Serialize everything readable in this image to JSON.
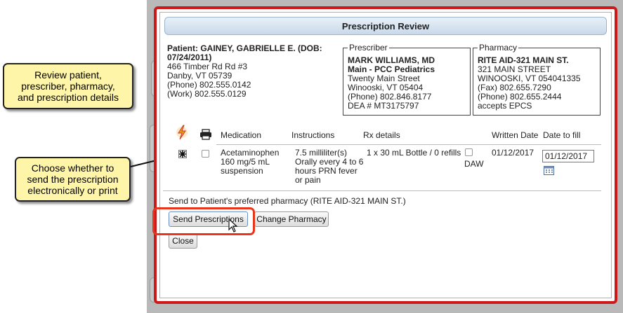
{
  "modal": {
    "title": "Prescription Review"
  },
  "patient": {
    "name_line1": "Patient: GAINEY, GABRIELLE E. (DOB:",
    "name_line2": "07/24/2011)",
    "address1": "466 Timber Rd Rd #3",
    "address2": "Danby, VT 05739",
    "phone": "(Phone) 802.555.0142",
    "work": "(Work) 802.555.0129"
  },
  "prescriber": {
    "legend": "Prescriber",
    "name": "MARK WILLIAMS, MD",
    "practice": "Main - PCC Pediatrics",
    "address1": "Twenty Main Street",
    "address2": "Winooski, VT 05404",
    "phone": "(Phone) 802.846.8177",
    "dea": "DEA # MT3175797"
  },
  "pharmacy": {
    "legend": "Pharmacy",
    "name": "RITE AID-321 MAIN ST.",
    "address1": "321 MAIN STREET",
    "address2": "WINOOSKI, VT 054041335",
    "fax": "(Fax) 802.655.7290",
    "phone": "(Phone) 802.655.2444",
    "epcs": "accepts EPCS"
  },
  "table": {
    "headers": {
      "medication": "Medication",
      "instructions": "Instructions",
      "rx_details": "Rx details",
      "written_date": "Written Date",
      "date_to_fill": "Date to fill"
    },
    "row": {
      "medication_1": "Acetaminophen",
      "medication_2": "160 mg/5 mL",
      "medication_3": "suspension",
      "instructions_1": "7.5 milliliter(s)",
      "instructions_2": "Orally every 4 to 6",
      "instructions_3": "hours PRN fever",
      "instructions_4": "or pain",
      "rx_details": "1 x 30 mL Bottle / 0 refills",
      "daw": "DAW",
      "written_date": "01/12/2017",
      "date_to_fill": "01/12/2017"
    }
  },
  "send_note": "Send to Patient's preferred pharmacy (RITE AID-321 MAIN ST.)",
  "buttons": {
    "send": "Send Prescriptions",
    "change_pharmacy": "Change Pharmacy",
    "close": "Close"
  },
  "callouts": {
    "review": "Review patient,\nprescriber, pharmacy,\nand prescription details",
    "choose": "Choose whether to\nsend the prescription\nelectronically or print"
  },
  "colors": {
    "modal_border": "#cc1a1a",
    "highlight": "#e8361c",
    "callout_bg": "#fff5a8"
  }
}
